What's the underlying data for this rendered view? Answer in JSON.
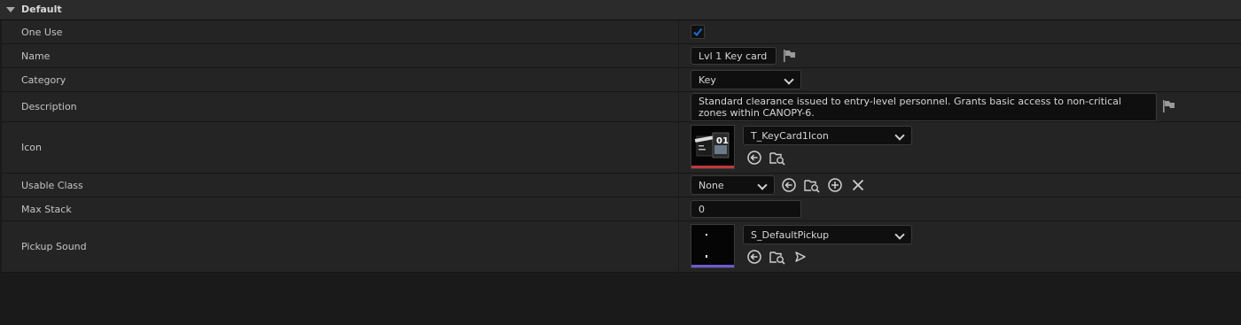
{
  "section": {
    "title": "Default"
  },
  "properties": {
    "one_use": {
      "label": "One Use",
      "checked": true
    },
    "name": {
      "label": "Name",
      "value": "Lvl 1 Key card"
    },
    "category": {
      "label": "Category",
      "value": "Key"
    },
    "description": {
      "label": "Description",
      "value": "Standard clearance issued to entry-level personnel. Grants basic access to non-critical zones within CANOPY-6."
    },
    "icon": {
      "label": "Icon",
      "asset": "T_KeyCard1Icon",
      "thumb_text": "01"
    },
    "usable_class": {
      "label": "Usable Class",
      "value": "None"
    },
    "max_stack": {
      "label": "Max Stack",
      "value": "0"
    },
    "pickup_sound": {
      "label": "Pickup Sound",
      "asset": "S_DefaultPickup"
    }
  },
  "icons": {
    "localize_flag": "flag-icon",
    "browse": "arrow-left-circle-icon",
    "find_in_browser": "folder-search-icon",
    "add": "plus-circle-icon",
    "clear": "close-icon",
    "play": "play-icon"
  },
  "colors": {
    "accent": "#1a6fd1",
    "texture_bar": "#c1393f",
    "sound_bar": "#6c5acf"
  }
}
